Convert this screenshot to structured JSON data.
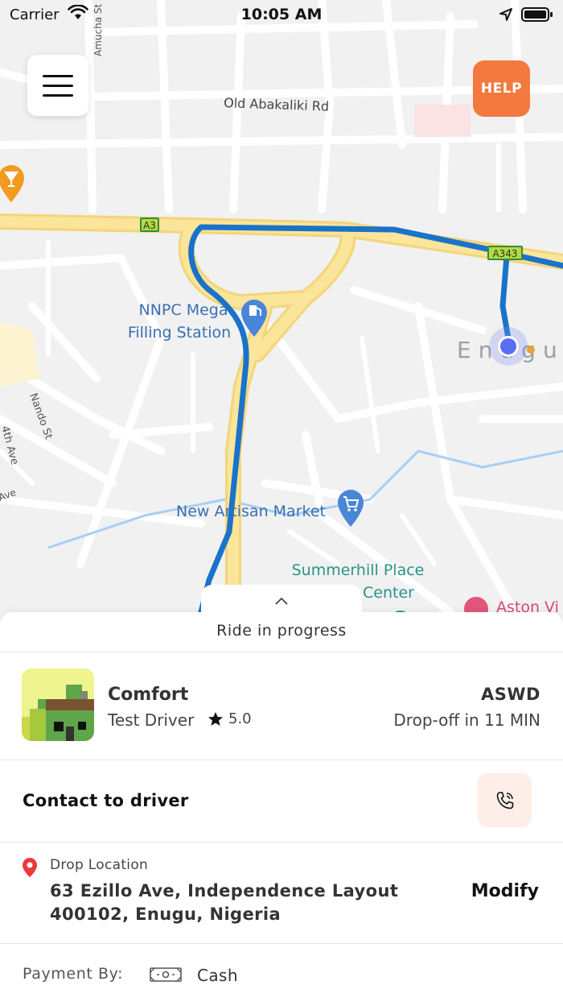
{
  "status_bar": {
    "carrier": "Carrier",
    "time": "10:05 AM"
  },
  "map": {
    "streets": {
      "old_abakaliki": "Old Abakaliki Rd",
      "amucha": "Amucha St",
      "nando": "Nando St",
      "ath_ave": "4th Ave",
      "ave": "Ave",
      "road_a3": "A3",
      "road_a343": "A343"
    },
    "places": {
      "nnpc_line1": "NNPC Mega",
      "nnpc_line2": "Filling Station",
      "market": "New Artisan Market",
      "summerhill_line1": "Summerhill Place",
      "summerhill_line2": "Center",
      "aston": "Aston Vi",
      "enugu": "Enugu"
    },
    "colors": {
      "route": "#1a73c9",
      "major_road": "#fbe59a",
      "help": "#f4793e"
    }
  },
  "buttons": {
    "menu_icon": "hamburger-menu-icon",
    "help": "HELP"
  },
  "sheet": {
    "status": "Ride in progress",
    "ride": {
      "car_type": "Comfort",
      "driver_name": "Test Driver",
      "rating": "5.0",
      "plate": "ASWD",
      "dropoff": "Drop-off in 11 MIN"
    },
    "contact": {
      "label": "Contact to driver",
      "icon": "phone-call-icon"
    },
    "drop": {
      "label": "Drop Location",
      "address": "63 Ezillo Ave, Independence Layout 400102, Enugu, Nigeria",
      "modify": "Modify"
    },
    "payment": {
      "label": "Payment By:",
      "method": "Cash",
      "icon": "cash-icon"
    }
  }
}
